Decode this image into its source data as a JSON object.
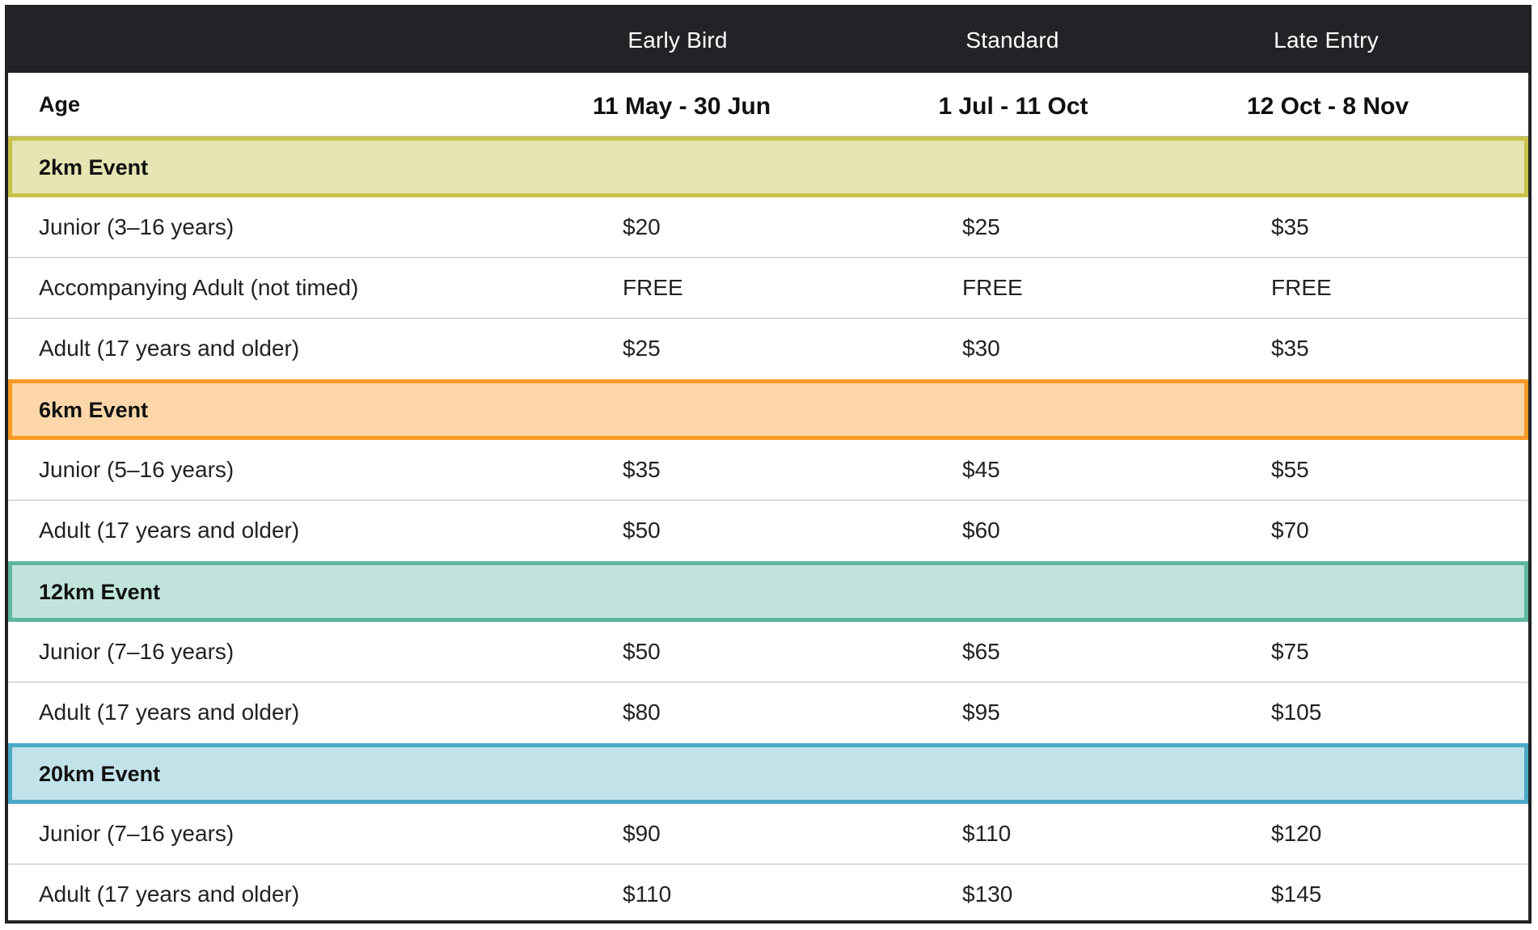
{
  "header": {
    "columns": [
      "Early Bird",
      "Standard",
      "Late Entry"
    ]
  },
  "subheader": {
    "age_label": "Age",
    "periods": [
      "11 May - 30 Jun",
      "1 Jul - 11 Oct",
      "12 Oct - 8 Nov"
    ]
  },
  "groups": [
    {
      "title": "2km Event",
      "border_color": "#c9c24a",
      "fill_color": "#e6e4b2",
      "rows": [
        {
          "age": "Junior (3–16 years)",
          "early": "$20",
          "standard": "$25",
          "late": "$35"
        },
        {
          "age": "Accompanying Adult (not timed)",
          "early": "FREE",
          "standard": "FREE",
          "late": "FREE"
        },
        {
          "age": "Adult (17 years and older)",
          "early": "$25",
          "standard": "$30",
          "late": "$35"
        }
      ]
    },
    {
      "title": "6km Event",
      "border_color": "#f59a24",
      "fill_color": "#fdd7a9",
      "rows": [
        {
          "age": "Junior (5–16 years)",
          "early": "$35",
          "standard": "$45",
          "late": "$55"
        },
        {
          "age": "Adult (17 years and older)",
          "early": "$50",
          "standard": "$60",
          "late": "$70"
        }
      ]
    },
    {
      "title": "12km Event",
      "border_color": "#5fb6a0",
      "fill_color": "#c0e4dc",
      "rows": [
        {
          "age": "Junior (7–16 years)",
          "early": "$50",
          "standard": "$65",
          "late": "$75"
        },
        {
          "age": "Adult (17 years and older)",
          "early": "$80",
          "standard": "$95",
          "late": "$105"
        }
      ]
    },
    {
      "title": "20km Event",
      "border_color": "#4aa9c7",
      "fill_color": "#c2e2ea",
      "rows": [
        {
          "age": "Junior (7–16 years)",
          "early": "$90",
          "standard": "$110",
          "late": "$120"
        },
        {
          "age": "Adult (17 years and older)",
          "early": "$110",
          "standard": "$130",
          "late": "$145"
        }
      ]
    }
  ]
}
